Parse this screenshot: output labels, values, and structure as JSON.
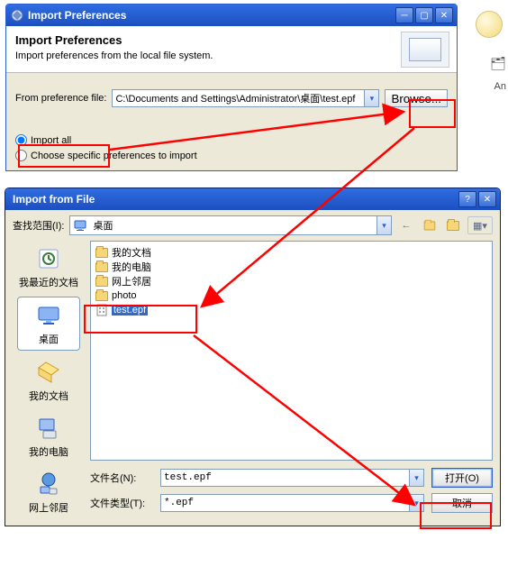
{
  "dlg1": {
    "title": "Import Preferences",
    "banner_title": "Import Preferences",
    "banner_text": "Import preferences from the local file system.",
    "pref_label": "From preference file:",
    "pref_value": "C:\\Documents and Settings\\Administrator\\桌面\\test.epf",
    "browse": "Browse...",
    "radio_all": "Import all",
    "radio_choose": "Choose specific preferences to import"
  },
  "dlg2": {
    "title": "Import from File",
    "lookin_label": "查找范围(I):",
    "lookin_value": "桌面",
    "places": [
      {
        "label": "我最近的文档",
        "icon": "recent"
      },
      {
        "label": "桌面",
        "icon": "desktop"
      },
      {
        "label": "我的文档",
        "icon": "mydocs"
      },
      {
        "label": "我的电脑",
        "icon": "mycomputer"
      },
      {
        "label": "网上邻居",
        "icon": "network"
      }
    ],
    "items": [
      {
        "label": "我的文档",
        "type": "folder"
      },
      {
        "label": "我的电脑",
        "type": "folder"
      },
      {
        "label": "网上邻居",
        "type": "folder"
      },
      {
        "label": "photo",
        "type": "folder"
      },
      {
        "label": "test.epf",
        "type": "file",
        "selected": true
      }
    ],
    "filename_label": "文件名(N):",
    "filename_value": "test.epf",
    "filetype_label": "文件类型(T):",
    "filetype_value": "*.epf",
    "open": "打开(O)",
    "cancel": "取消"
  },
  "bg": {
    "an": "An"
  }
}
